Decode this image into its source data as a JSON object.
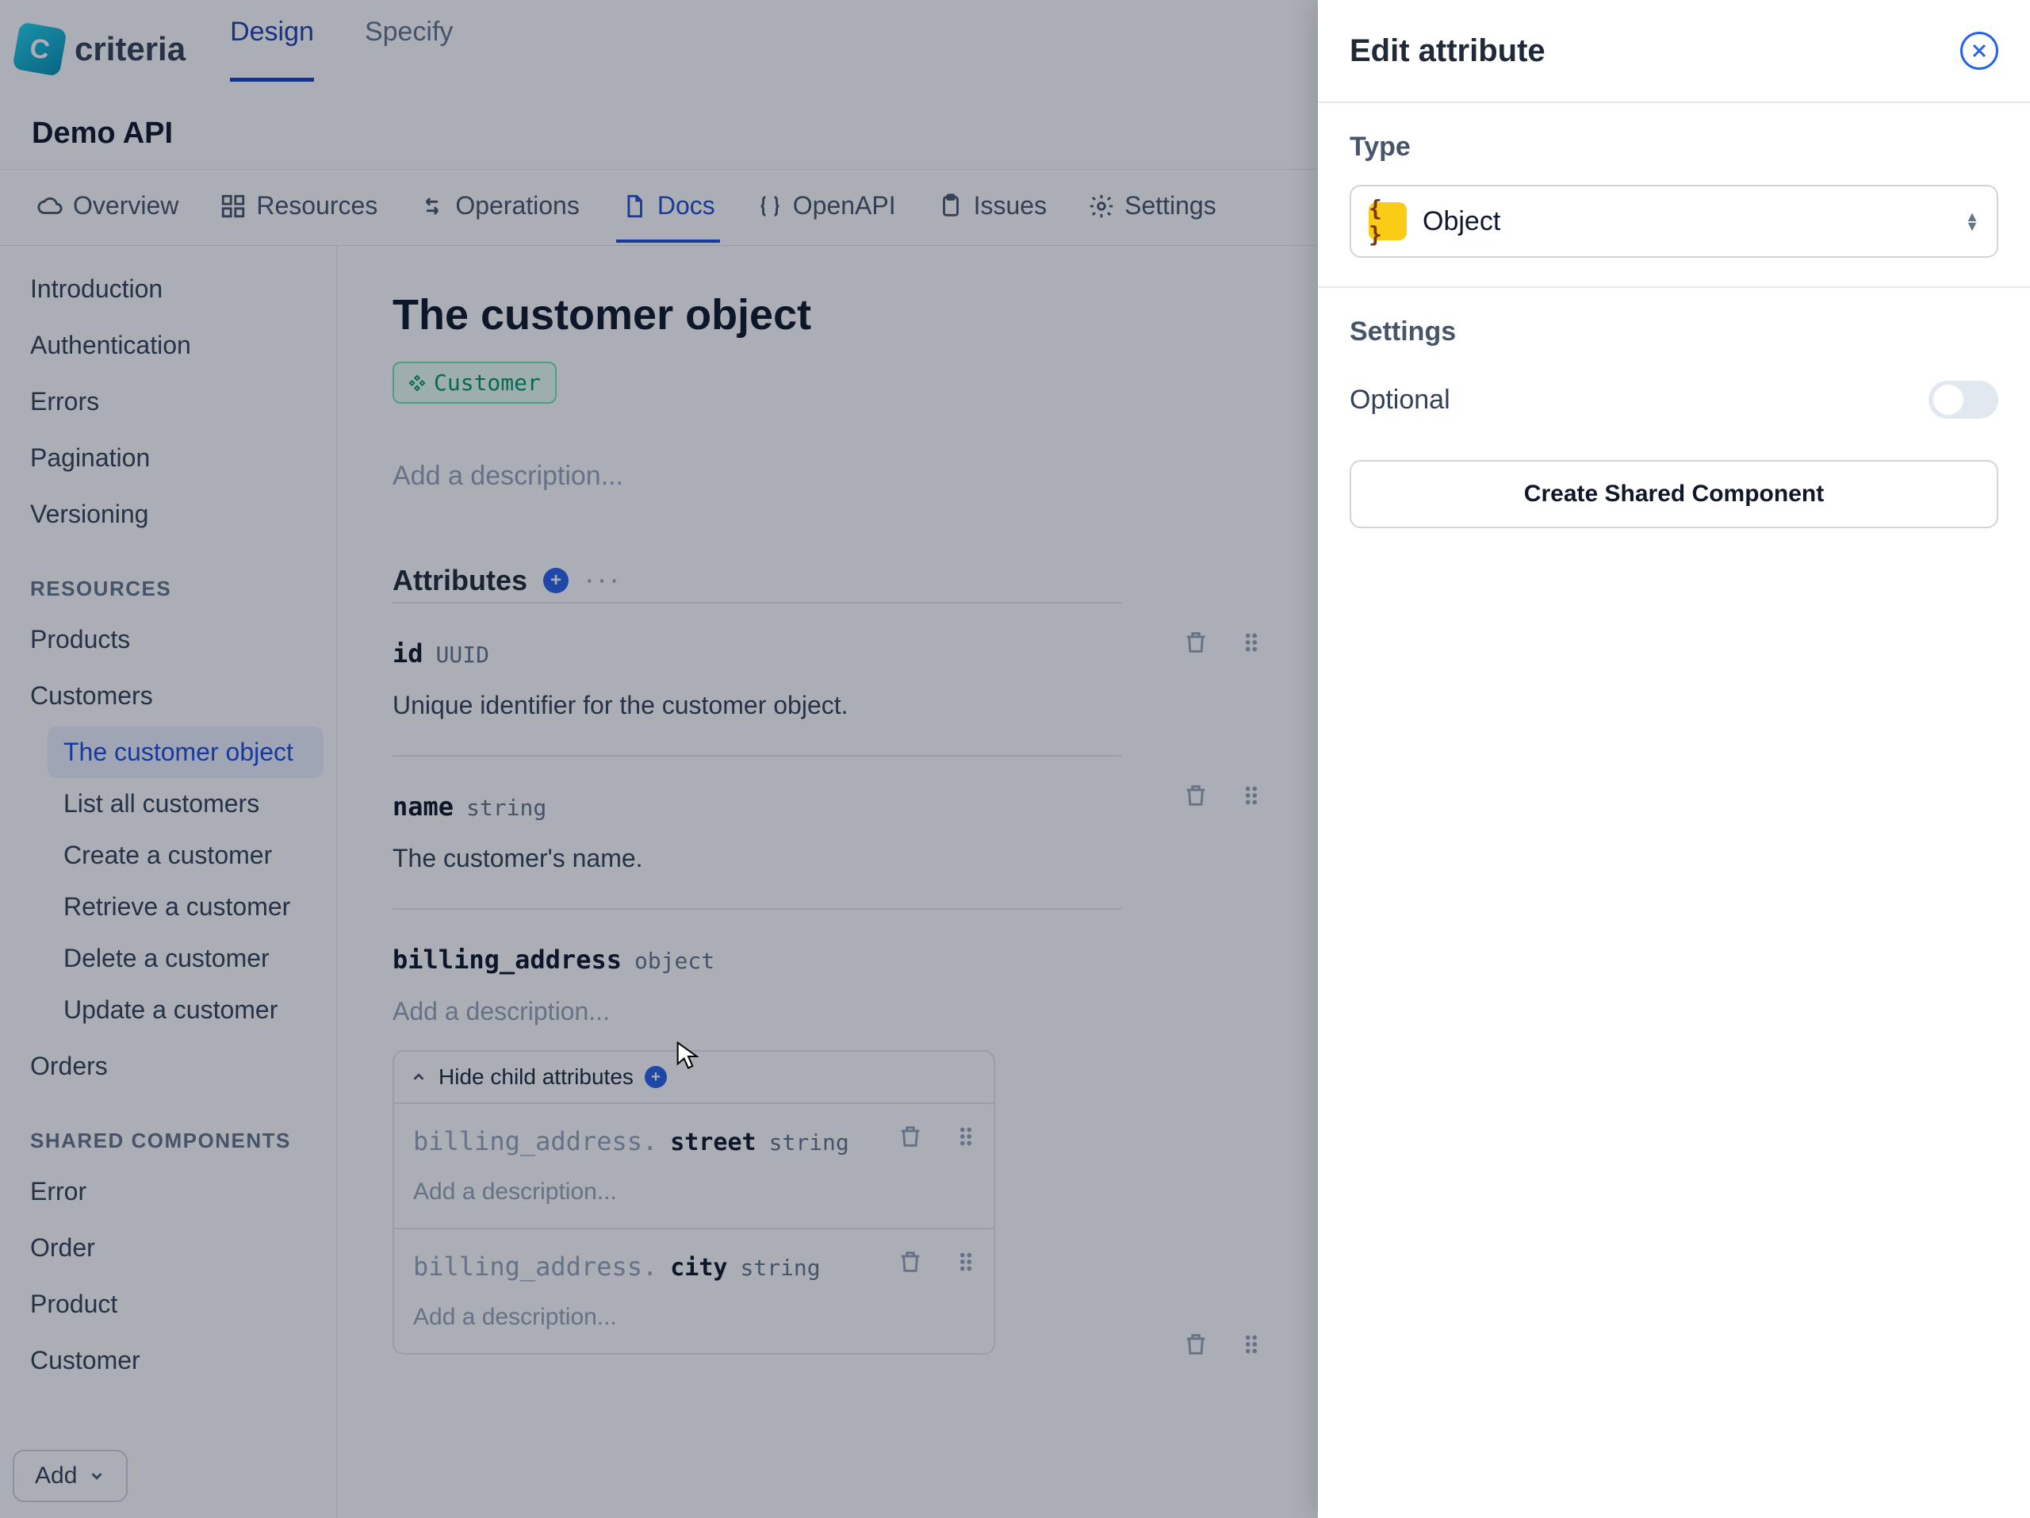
{
  "brand": "criteria",
  "topnav": {
    "design": "Design",
    "specify": "Specify"
  },
  "project": "Demo API",
  "subtabs": {
    "overview": "Overview",
    "resources": "Resources",
    "operations": "Operations",
    "docs": "Docs",
    "openapi": "OpenAPI",
    "issues": "Issues",
    "settings": "Settings"
  },
  "sidebar": {
    "toplinks": [
      "Introduction",
      "Authentication",
      "Errors",
      "Pagination",
      "Versioning"
    ],
    "sections": {
      "resources_label": "RESOURCES",
      "resources": [
        "Products",
        "Customers",
        "Orders"
      ],
      "customers_children": [
        "The customer object",
        "List all customers",
        "Create a customer",
        "Retrieve a customer",
        "Delete a customer",
        "Update a customer"
      ],
      "shared_label": "SHARED COMPONENTS",
      "shared": [
        "Error",
        "Order",
        "Product",
        "Customer"
      ]
    },
    "add_btn": "Add"
  },
  "main": {
    "title": "The customer object",
    "tag": "Customer",
    "desc_placeholder": "Add a description...",
    "attributes_label": "Attributes",
    "attributes": [
      {
        "name": "id",
        "type": "UUID",
        "desc": "Unique identifier for the customer object."
      },
      {
        "name": "name",
        "type": "string",
        "desc": "The customer's name."
      },
      {
        "name": "billing_address",
        "type": "object",
        "desc": ""
      }
    ],
    "child_toggle": "Hide child attributes",
    "children": [
      {
        "prefix": "billing_address.",
        "name": "street",
        "type": "string",
        "desc": ""
      },
      {
        "prefix": "billing_address.",
        "name": "city",
        "type": "string",
        "desc": ""
      }
    ]
  },
  "panel": {
    "title": "Edit attribute",
    "type_label": "Type",
    "type_value": "Object",
    "type_icon_text": "{ }",
    "settings_label": "Settings",
    "optional_label": "Optional",
    "share_btn": "Create Shared Component"
  }
}
